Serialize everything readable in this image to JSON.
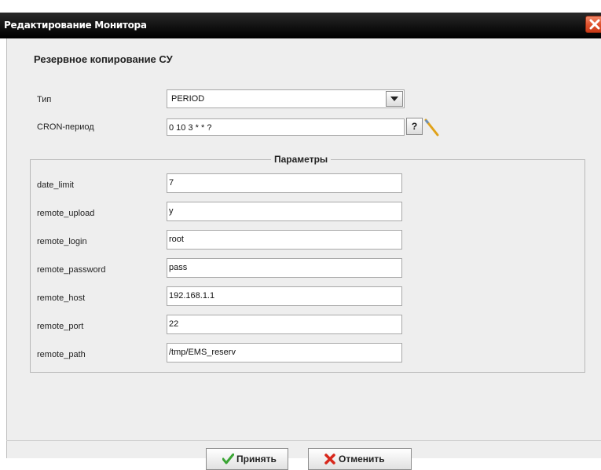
{
  "window": {
    "title": "Редактирование Монитора"
  },
  "section": {
    "title": "Резервное копирование СУ"
  },
  "form": {
    "type_label": "Тип",
    "type_value": "PERIOD",
    "cron_label": "CRON-период",
    "cron_value": "0 10 3 * * ?",
    "help_label": "?"
  },
  "params": {
    "title": "Параметры",
    "rows": [
      {
        "label": "date_limit",
        "value": "7"
      },
      {
        "label": "remote_upload",
        "value": "y"
      },
      {
        "label": "remote_login",
        "value": "root"
      },
      {
        "label": "remote_password",
        "value": "pass"
      },
      {
        "label": "remote_host",
        "value": "192.168.1.1"
      },
      {
        "label": "remote_port",
        "value": "22"
      },
      {
        "label": "remote_path",
        "value": "/tmp/EMS_reserv"
      }
    ]
  },
  "buttons": {
    "accept": "Принять",
    "cancel": "Отменить"
  },
  "colors": {
    "titlebar": "#000000",
    "close": "#e0532f",
    "accept_icon": "#3aa534",
    "cancel_icon": "#d8281c"
  }
}
